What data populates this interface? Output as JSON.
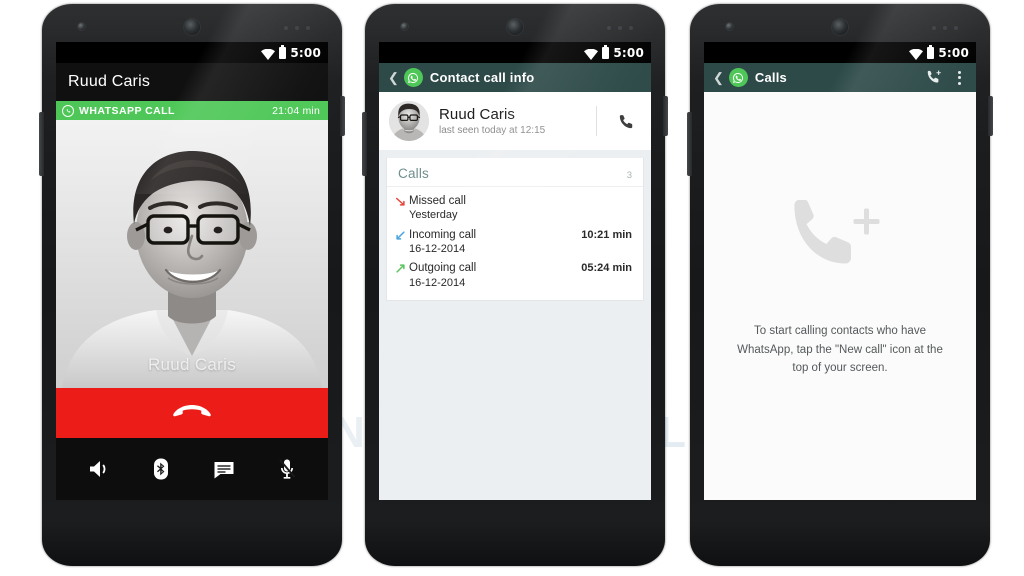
{
  "watermark": {
    "logo": "aw",
    "text_a": "ANDROID",
    "text_b": "WORLD"
  },
  "status_bar": {
    "time": "5:00",
    "wifi_icon": "wifi-icon",
    "battery_icon": "battery-icon"
  },
  "nav_bar": {
    "back": "back-icon",
    "home": "home-icon",
    "recents": "recents-icon"
  },
  "phone1": {
    "name": "in-call-screen",
    "title": "Ruud Caris",
    "banner": {
      "label": "WHATSAPP CALL",
      "duration": "21:04 min",
      "logo": "whatsapp-icon"
    },
    "photo_caption": "Ruud Caris",
    "end_call": {
      "label": "end-call",
      "color": "#ec1c18"
    },
    "controls": [
      {
        "name": "speaker-button",
        "icon": "speaker-icon",
        "active": false
      },
      {
        "name": "bluetooth-button",
        "icon": "bluetooth-icon",
        "active": true
      },
      {
        "name": "chat-button",
        "icon": "chat-icon",
        "active": false
      },
      {
        "name": "mute-button",
        "icon": "mic-muted-icon",
        "active": false
      }
    ]
  },
  "phone2": {
    "name": "contact-call-info-screen",
    "appbar": {
      "title": "Contact call info",
      "back_icon": "back-chevron-icon",
      "logo": "whatsapp-icon"
    },
    "contact": {
      "name": "Ruud Caris",
      "status": "last seen today at 12:15",
      "avatar": "contact-avatar",
      "call_icon": "phone-icon"
    },
    "calls_section": {
      "title": "Calls",
      "count": "3",
      "rows": [
        {
          "type": "Missed call",
          "date": "Yesterday",
          "duration": "",
          "arrow": "missed-call-arrow",
          "color": "#e8453c"
        },
        {
          "type": "Incoming call",
          "date": "16-12-2014",
          "duration": "10:21 min",
          "arrow": "incoming-call-arrow",
          "color": "#4aa3df"
        },
        {
          "type": "Outgoing call",
          "date": "16-12-2014",
          "duration": "05:24 min",
          "arrow": "outgoing-call-arrow",
          "color": "#5cc45f"
        }
      ]
    }
  },
  "phone3": {
    "name": "calls-empty-screen",
    "appbar": {
      "title": "Calls",
      "back_icon": "back-chevron-icon",
      "logo": "whatsapp-icon",
      "new_call_icon": "new-call-icon",
      "overflow_icon": "overflow-menu-icon"
    },
    "empty": {
      "icon": "new-call-placeholder-icon",
      "message": "To start calling contacts who have WhatsApp, tap the \"New call\" icon at the top of your screen."
    }
  },
  "colors": {
    "whatsapp_green": "#4fc758",
    "appbar_teal": "#2d4a48",
    "end_call_red": "#ec1c18",
    "accent_blue": "#1b86c4"
  }
}
